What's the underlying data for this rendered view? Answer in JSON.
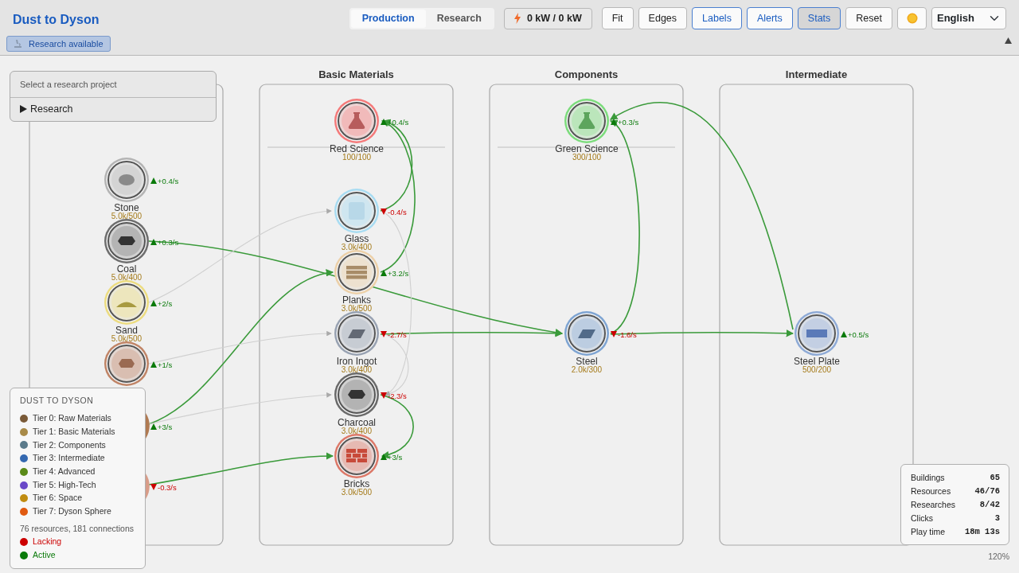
{
  "app": {
    "title": "Dust to Dyson"
  },
  "tabs": [
    {
      "label": "Production",
      "selected": true
    },
    {
      "label": "Research",
      "selected": false
    }
  ],
  "power": {
    "reading": "0 kW / 0 kW"
  },
  "buttons": [
    {
      "label": "Fit",
      "on": false,
      "pressed": false
    },
    {
      "label": "Edges",
      "on": false,
      "pressed": false
    },
    {
      "label": "Labels",
      "on": true,
      "pressed": false
    },
    {
      "label": "Alerts",
      "on": true,
      "pressed": false
    },
    {
      "label": "Stats",
      "on": true,
      "pressed": true
    },
    {
      "label": "Reset",
      "on": false,
      "pressed": false
    }
  ],
  "language": {
    "value": "English"
  },
  "notice": {
    "label": "Research available"
  },
  "header_collapsed": false,
  "columns": [
    {
      "divided": false,
      "nodes": [
        {
          "kind": "stone",
          "name": "Stone",
          "amount": "5.0k/500",
          "rate": "+0.4/s",
          "rising": true,
          "color": "#b4b4b4"
        },
        {
          "kind": "coal",
          "name": "Coal",
          "amount": "5.0k/400",
          "rate": "+0.3/s",
          "rising": true,
          "color": "#6e6e6e"
        },
        {
          "kind": "sand",
          "name": "Sand",
          "amount": "5.0k/500",
          "rate": "+2/s",
          "rising": true,
          "color": "#ecdc80"
        },
        {
          "kind": "clay",
          "rate": "+1/s",
          "rising": true,
          "color": "#c08466"
        },
        {
          "kind": "covered",
          "rate": "+3/s",
          "rising": true,
          "color": "#b07a52"
        },
        {
          "kind": "covered",
          "rate": "-0.3/s",
          "rising": false,
          "color": "#d89c88"
        }
      ]
    },
    {
      "title": "Basic Materials",
      "divided": true,
      "nodes": [
        {
          "kind": "flask",
          "name": "Red Science",
          "amount": "100/100",
          "rate": "+0.4/s",
          "rising": true,
          "color": "#f47a7a"
        },
        {
          "kind": "glass",
          "name": "Glass",
          "amount": "3.0k/400",
          "rate": "-0.4/s",
          "rising": false,
          "color": "#a8dcf2"
        },
        {
          "kind": "planks",
          "name": "Planks",
          "amount": "3.0k/500",
          "rate": "+3.2/s",
          "rising": true,
          "color": "#ecd0a8"
        },
        {
          "kind": "ingot",
          "name": "Iron Ingot",
          "amount": "3.0k/400",
          "rate": "-2.7/s",
          "rising": false,
          "color": "#98a2b2"
        },
        {
          "kind": "coal",
          "name": "Charcoal",
          "amount": "3.0k/400",
          "rate": "-2.3/s",
          "rising": false,
          "color": "#6a6a6a"
        },
        {
          "kind": "brick",
          "name": "Bricks",
          "amount": "3.0k/500",
          "rate": "+3/s",
          "rising": true,
          "color": "#dc7868"
        }
      ]
    },
    {
      "title": "Components",
      "divided": true,
      "nodes": [
        {
          "kind": "flask",
          "name": "Green Science",
          "amount": "300/100",
          "rate": "+0.3/s",
          "rising": true,
          "color": "#7cdc7c"
        },
        {
          "kind": "ingot",
          "name": "Steel",
          "amount": "2.0k/300",
          "rate": "-1.6/s",
          "rising": false,
          "color": "#7ea4d2"
        }
      ]
    },
    {
      "title": "Intermediate",
      "divided": false,
      "nodes": [
        {
          "kind": "plate",
          "name": "Steel Plate",
          "amount": "500/200",
          "rate": "+0.5/s",
          "rising": true,
          "color": "#8eaad6"
        }
      ]
    }
  ],
  "edges": [
    {
      "active": true
    },
    {
      "active": true
    },
    {
      "active": true
    },
    {
      "active": true
    },
    {
      "active": true
    },
    {
      "active": true
    },
    {
      "active": true
    },
    {
      "active": true
    },
    {
      "active": true
    },
    {
      "active": true
    },
    {
      "active": false
    },
    {
      "active": false
    },
    {
      "active": false
    },
    {
      "active": false
    },
    {
      "active": false
    }
  ],
  "research_panel": {
    "prompt": "Select a research project",
    "section": "Research",
    "expanded": false
  },
  "legend": {
    "title": "DUST TO DYSON",
    "tiers": [
      {
        "label": "Tier 0: Raw Materials",
        "color": "#7a5a38"
      },
      {
        "label": "Tier 1: Basic Materials",
        "color": "#a88a48"
      },
      {
        "label": "Tier 2: Components",
        "color": "#5a7a8a"
      },
      {
        "label": "Tier 3: Intermediate",
        "color": "#3468b0"
      },
      {
        "label": "Tier 4: Advanced",
        "color": "#5a8a18"
      },
      {
        "label": "Tier 5: High-Tech",
        "color": "#6a48c8"
      },
      {
        "label": "Tier 6: Space",
        "color": "#c08c10"
      },
      {
        "label": "Tier 7: Dyson Sphere",
        "color": "#e05a10"
      }
    ],
    "summary": "76 resources, 181 connections",
    "states": [
      {
        "label": "Lacking",
        "color": "#cc0000"
      },
      {
        "label": "Active",
        "color": "#0a7a0a"
      }
    ]
  },
  "stats": [
    {
      "label": "Buildings",
      "value": "65"
    },
    {
      "label": "Resources",
      "value": "46/76"
    },
    {
      "label": "Researches",
      "value": "8/42"
    },
    {
      "label": "Clicks",
      "value": "3"
    },
    {
      "label": "Play time",
      "value": "18m 13s"
    }
  ],
  "zoom": "120%"
}
